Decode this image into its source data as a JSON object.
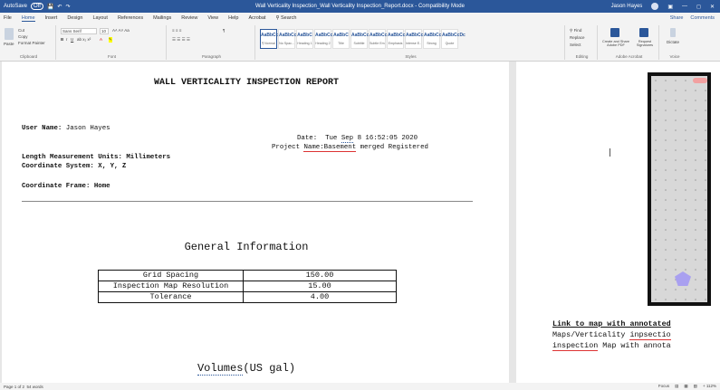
{
  "titlebar": {
    "autosave": "AutoSave",
    "autosave_state": "Off",
    "title": "Wall Verticality Inspection_Wall Verticality Inspection_Report.docx - Compatibility Mode",
    "user": "Jason Hayes"
  },
  "ribbon_tabs": [
    "File",
    "Home",
    "Insert",
    "Design",
    "Layout",
    "References",
    "Mailings",
    "Review",
    "View",
    "Help",
    "Acrobat",
    "Search"
  ],
  "ribbon_tabs_active": "Home",
  "ribbon_right": {
    "share": "Share",
    "comments": "Comments"
  },
  "ribbon": {
    "clipboard": {
      "label": "Clipboard",
      "paste": "Paste",
      "cut": "Cut",
      "copy": "Copy",
      "format_painter": "Format Painter"
    },
    "font": {
      "label": "Font",
      "family": "Sans Serif",
      "size": "10"
    },
    "paragraph": {
      "label": "Paragraph"
    },
    "styles": {
      "label": "Styles",
      "items": [
        {
          "preview": "AaBbCcDc",
          "name": "¶ Normal"
        },
        {
          "preview": "AaBbCcDc",
          "name": "No Spac..."
        },
        {
          "preview": "AaBbC",
          "name": "Heading 1"
        },
        {
          "preview": "AaBbCc",
          "name": "Heading 2"
        },
        {
          "preview": "AaBbC",
          "name": "Title"
        },
        {
          "preview": "AaBbCcD",
          "name": "Subtitle"
        },
        {
          "preview": "AaBbCcDc",
          "name": "Subtle Em..."
        },
        {
          "preview": "AaBbCcDc",
          "name": "Emphasis"
        },
        {
          "preview": "AaBbCcDc",
          "name": "Intense E..."
        },
        {
          "preview": "AaBbCcDc",
          "name": "Strong"
        },
        {
          "preview": "AaBbCcDc",
          "name": "Quote"
        }
      ]
    },
    "editing": {
      "label": "Editing",
      "find": "Find",
      "replace": "Replace",
      "select": "Select"
    },
    "adobe": {
      "label": "Adobe Acrobat",
      "create": "Create and Share Adobe PDF",
      "request": "Request Signatures"
    },
    "voice": {
      "label": "Voice",
      "dictate": "Dictate"
    }
  },
  "report": {
    "title": "WALL VERTICALITY INSPECTION REPORT",
    "user_label": "User Name:",
    "user_value": "Jason Hayes",
    "date_label": "Date:",
    "date_dow": "Tue",
    "date_month": "Sep",
    "date_rest": "8 16:52:05 2020",
    "project_label": "Project",
    "project_label2": "Name:",
    "project_word1": "Basement",
    "project_rest": "merged Registered",
    "length_units": "Length Measurement Units: Millimeters",
    "coord_system": "Coordinate System: X, Y, Z",
    "coord_frame": "Coordinate Frame: Home",
    "general_info": "General Information",
    "table": [
      {
        "label": "Grid Spacing",
        "value": "150.00"
      },
      {
        "label": "Inspection Map Resolution",
        "value": "15.00"
      },
      {
        "label": "Tolerance",
        "value": "4.00"
      }
    ],
    "volumes_title": "Volumes",
    "volumes_units": "(US gal)"
  },
  "page2": {
    "link_text": "Link to map with annotated",
    "path_line1_a": "Maps/Verticality",
    "path_line1_b": "inpsectio",
    "path_line2_a": "inspection",
    "path_line2_b": "Map with annota"
  },
  "statusbar": {
    "page": "Page 1 of 2",
    "words": "54 words",
    "focus": "Focus",
    "zoom": "+ 112%"
  }
}
